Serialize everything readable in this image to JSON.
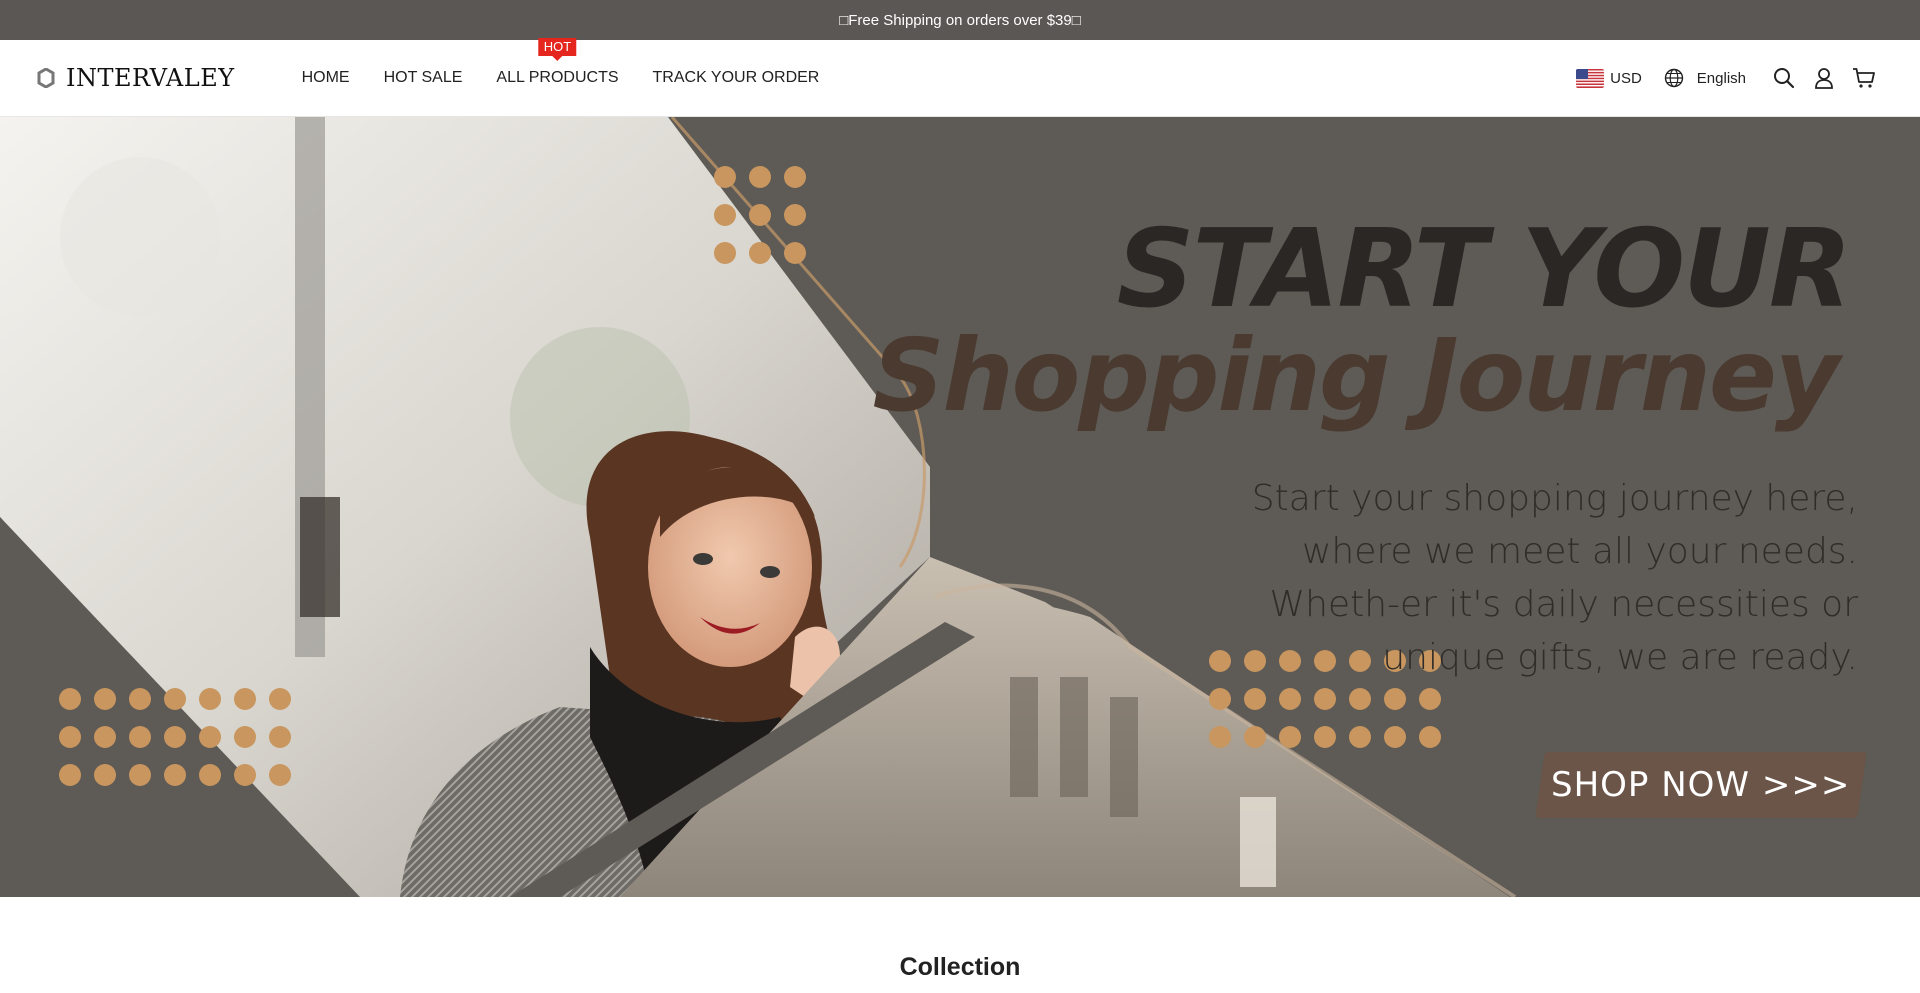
{
  "announcement": {
    "text": "□Free Shipping on orders over $39□"
  },
  "header": {
    "brand": "INTERVALEY",
    "nav": [
      {
        "label": "HOME"
      },
      {
        "label": "HOT SALE"
      },
      {
        "label": "ALL PRODUCTS",
        "badge": "HOT"
      },
      {
        "label": "TRACK YOUR ORDER"
      }
    ],
    "currency": "USD",
    "language": "English",
    "icons": [
      "search-icon",
      "account-icon",
      "cart-icon"
    ]
  },
  "hero": {
    "title_line1": "START YOUR",
    "title_line2": "Shopping Journey",
    "description": "Start your shopping journey here, where we meet all your needs. Wheth-er it's daily necessities or unique gifts, we are ready.",
    "cta": "SHOP NOW >>>"
  },
  "section": {
    "title": "Collection"
  },
  "colors": {
    "announce_bg": "#5b5754",
    "hero_bg": "#5e5a55",
    "accent_dots": "#c8965e",
    "hot_badge": "#e5261f",
    "cta_bg": "#6b5448"
  }
}
